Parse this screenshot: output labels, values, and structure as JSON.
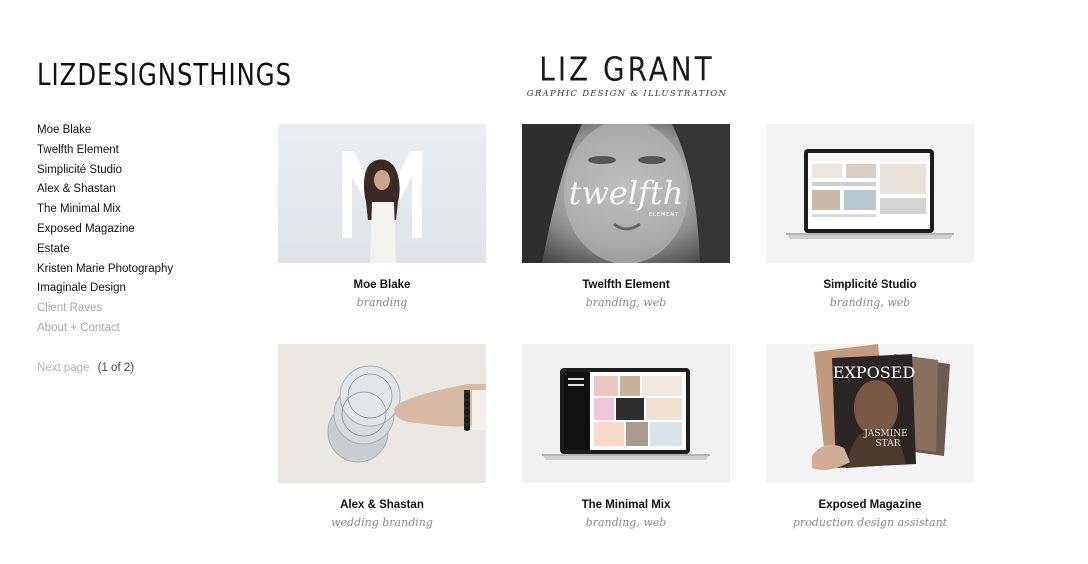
{
  "site": {
    "logo": "LIZDESIGNSTHINGS"
  },
  "header": {
    "name": "LIZ GRANT",
    "tagline": "GRAPHIC DESIGN & ILLUSTRATION"
  },
  "sidebar": {
    "items": [
      {
        "label": "Moe Blake"
      },
      {
        "label": "Twelfth Element"
      },
      {
        "label": "Simplicité Studio"
      },
      {
        "label": "Alex & Shastan"
      },
      {
        "label": "The Minimal Mix"
      },
      {
        "label": "Exposed Magazine"
      },
      {
        "label": "Estate"
      },
      {
        "label": "Kristen Marie Photography"
      },
      {
        "label": "Imaginale Design"
      },
      {
        "label": "Client Raves"
      },
      {
        "label": "About + Contact"
      }
    ]
  },
  "pagination": {
    "next_label": "Next page",
    "count": "(1 of 2)"
  },
  "projects": [
    {
      "title": "Moe Blake",
      "tags": "branding"
    },
    {
      "title": "Twelfth Element",
      "tags": "branding, web"
    },
    {
      "title": "Simplicité Studio",
      "tags": "branding, web"
    },
    {
      "title": "Alex & Shastan",
      "tags": "wedding branding"
    },
    {
      "title": "The Minimal Mix",
      "tags": "branding, web"
    },
    {
      "title": "Exposed Magazine",
      "tags": "production design assistant"
    }
  ],
  "thumb_text": {
    "twelfth_script": "twelfth",
    "twelfth_small": "ELEMENT",
    "magazine_title": "EXPOSED",
    "magazine_cover_name": "JASMINE",
    "magazine_cover_word": "STAR"
  },
  "colors": {
    "text": "#111111",
    "muted": "#a8a8a8",
    "tag": "#888888"
  }
}
